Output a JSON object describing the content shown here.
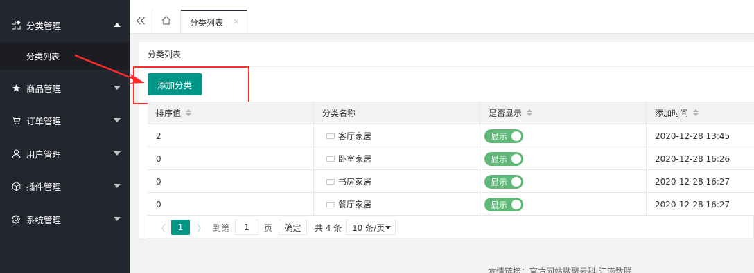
{
  "sidebar": {
    "items": [
      {
        "label": "分类管理",
        "icon": "category-icon",
        "expanded": true
      },
      {
        "label": "商品管理",
        "icon": "star-icon"
      },
      {
        "label": "订单管理",
        "icon": "cart-icon"
      },
      {
        "label": "用户管理",
        "icon": "user-icon"
      },
      {
        "label": "插件管理",
        "icon": "cube-icon"
      },
      {
        "label": "系统管理",
        "icon": "gear-icon"
      }
    ],
    "sub_items": [
      {
        "label": "分类列表"
      }
    ]
  },
  "tabs": {
    "collapse_icon": "double-chevron-left-icon",
    "home_icon": "home-icon",
    "active": {
      "label": "分类列表",
      "close": "×"
    }
  },
  "card": {
    "title": "分类列表",
    "add_button": "添加分类"
  },
  "table": {
    "headers": [
      "排序值",
      "分类名称",
      "是否显示",
      "添加时间"
    ],
    "rows": [
      {
        "sort": "2",
        "name": "客厅家居",
        "show": "显示",
        "time": "2020-12-28 13:45"
      },
      {
        "sort": "0",
        "name": "卧室家居",
        "show": "显示",
        "time": "2020-12-28 16:26"
      },
      {
        "sort": "0",
        "name": "书房家居",
        "show": "显示",
        "time": "2020-12-28 16:27"
      },
      {
        "sort": "0",
        "name": "餐厅家居",
        "show": "显示",
        "time": "2020-12-28 16:27"
      }
    ]
  },
  "pagination": {
    "prev": "〈",
    "current": "1",
    "next": "〉",
    "goto_label": "到第",
    "goto_value": "1",
    "page_label": "页",
    "ok_label": "确定",
    "total_label": "共 4 条",
    "page_size": "10 条/页"
  },
  "footer": {
    "text": "友情链接：官方网站微聚云科    江南数联"
  },
  "colors": {
    "sidebar_bg": "#23262e",
    "accent": "#009688",
    "switch_on": "#5fb878",
    "annotation": "#ff2a2a"
  }
}
